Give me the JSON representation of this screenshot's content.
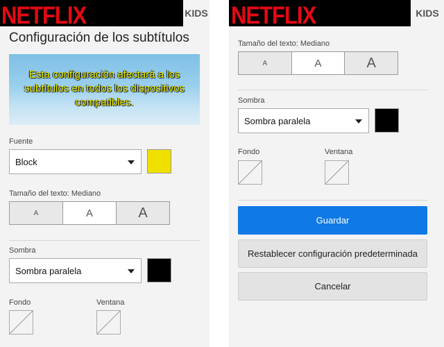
{
  "colors": {
    "netflix_red": "#e50914",
    "primary_button": "#0f7ae5",
    "font_color_swatch": "#f0e000",
    "shadow_color_swatch": "#000000"
  },
  "left": {
    "brand": "NETFLIX",
    "kids": "KIDS",
    "heading": "Configuración de los subtítulos",
    "preview_text": "Esta configuración afectará a los subtítulos en todos los dispositivos compatibles.",
    "font_label": "Fuente",
    "font_value": "Block",
    "size_label": "Tamaño del texto: Mediano",
    "size_options": [
      "A",
      "A",
      "A"
    ],
    "shadow_label": "Sombra",
    "shadow_value": "Sombra paralela",
    "background_label": "Fondo",
    "window_label": "Ventana"
  },
  "right": {
    "brand": "NETFLIX",
    "kids": "KIDS",
    "size_label": "Tamaño del texto: Mediano",
    "size_options": [
      "A",
      "A",
      "A"
    ],
    "shadow_label": "Sombra",
    "shadow_value": "Sombra paralela",
    "background_label": "Fondo",
    "window_label": "Ventana",
    "save_label": "Guardar",
    "reset_label": "Restablecer configuración predeterminada",
    "cancel_label": "Cancelar"
  }
}
